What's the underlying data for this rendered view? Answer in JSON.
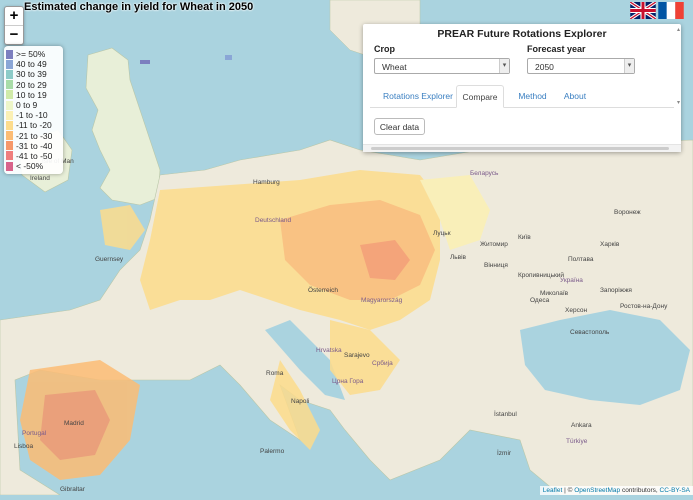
{
  "map": {
    "title": "Estimated change in yield for Wheat in 2050",
    "zoom_in": "+",
    "zoom_out": "−",
    "attribution": {
      "leaflet": "Leaflet",
      "sep": "| ©",
      "osm": "OpenStreetMap",
      "contrib": "contributors,",
      "cc": "CC-BY-SA"
    }
  },
  "legend": [
    {
      "label": ">= 50%",
      "color": "#7c7fbf"
    },
    {
      "label": "40 to 49",
      "color": "#8aa6d6"
    },
    {
      "label": "30 to 39",
      "color": "#8ccbc8"
    },
    {
      "label": "20 to 29",
      "color": "#a8dca8"
    },
    {
      "label": "10 to 19",
      "color": "#cfeaa8"
    },
    {
      "label": "0 to 9",
      "color": "#eef6c8"
    },
    {
      "label": "-1 to -10",
      "color": "#fbf0b4"
    },
    {
      "label": "-11 to -20",
      "color": "#fddc8c"
    },
    {
      "label": "-21 to -30",
      "color": "#fcbc74"
    },
    {
      "label": "-31 to -40",
      "color": "#f6986a"
    },
    {
      "label": "-41 to -50",
      "color": "#ef7e7e"
    },
    {
      "label": "< -50%",
      "color": "#d8648c"
    }
  ],
  "flags": {
    "en": "uk-flag-icon",
    "fr": "france-flag-icon"
  },
  "panel": {
    "title": "PREAR Future Rotations Explorer",
    "crop_label": "Crop",
    "crop_value": "Wheat",
    "year_label": "Forecast year",
    "year_value": "2050",
    "tabs": [
      "Rotations Explorer",
      "Compare",
      "Method",
      "About"
    ],
    "active_tab": "Compare",
    "clear_button": "Clear data"
  },
  "places": {
    "isle_of_man": "Isle of Man",
    "ireland": "Ireland",
    "guernsey": "Guernsey",
    "hamburg": "Hamburg",
    "deutschland": "Deutschland",
    "osterreich": "Österreich",
    "magyarorszag": "Magyarország",
    "hrvatska": "Hrvatska",
    "belarus": "Беларусь",
    "ukraina": "Україна",
    "kyiv": "Київ",
    "odesa": "Одеса",
    "kherson": "Херсон",
    "mykolaiv": "Миколаїв",
    "kropyvnytskyi": "Кропивницький",
    "zaporizhzhia": "Запоріжжя",
    "voronezh": "Воронеж",
    "rostov": "Ростов-на-Дону",
    "crna_gora": "Црна Гора",
    "srbija": "Србија",
    "sarajevo": "Sarajevo",
    "roma": "Roma",
    "napoli": "Napoli",
    "palermo": "Palermo",
    "turkiye": "Türkiye",
    "istanbul": "İstanbul",
    "ankara": "Ankara",
    "izmir": "İzmir",
    "gibraltar": "Gibraltar",
    "portugal": "Portugal",
    "lisboa": "Lisboa",
    "madrid": "Madrid",
    "lviv": "Львів",
    "lutsk": "Луцьк",
    "zhytomyr": "Житомир",
    "vinnytsia": "Вінниця",
    "poltava": "Полтава",
    "kharkiv": "Харків",
    "sevastopol": "Севастополь"
  }
}
